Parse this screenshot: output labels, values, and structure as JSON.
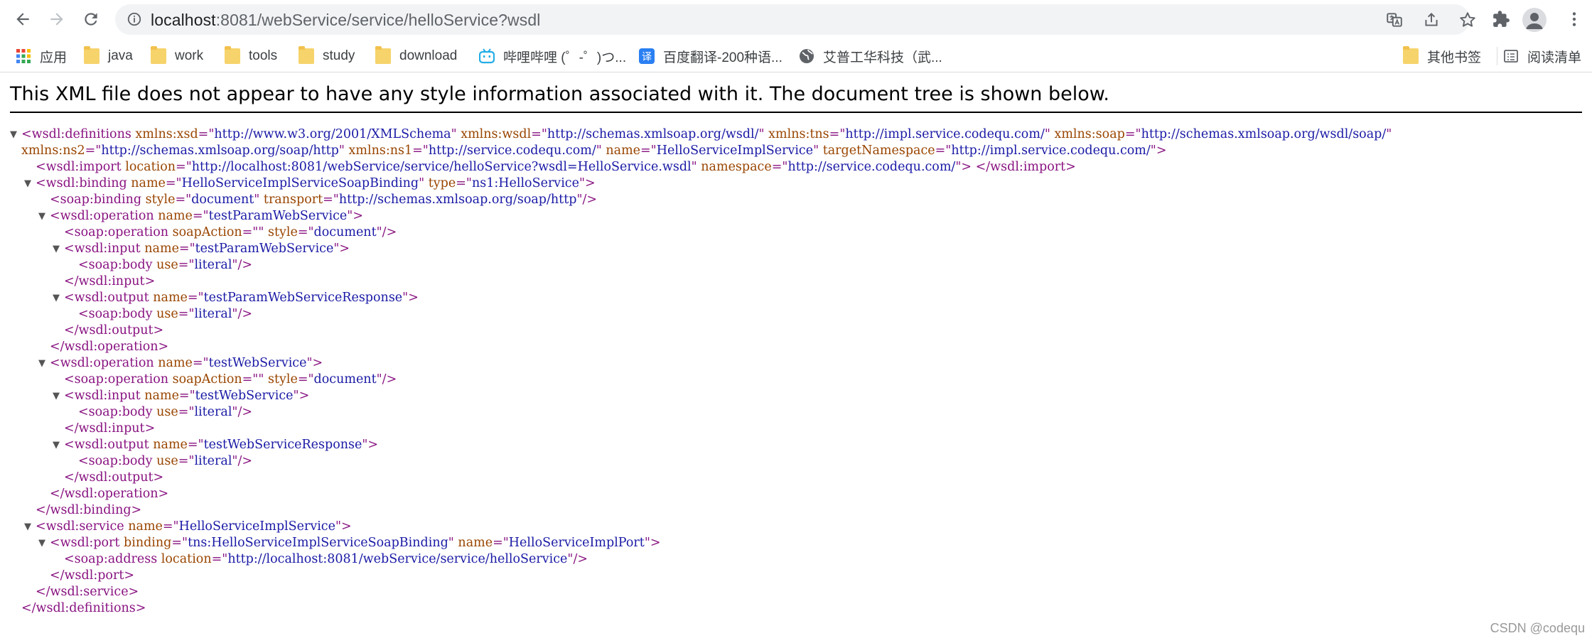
{
  "browser": {
    "url_host": "localhost",
    "url_path": ":8081/webService/service/helloService?wsdl",
    "bookmarks": [
      {
        "label": "应用",
        "icon": "apps-grid-icon"
      },
      {
        "label": "java",
        "icon": "folder-icon"
      },
      {
        "label": "work",
        "icon": "folder-icon"
      },
      {
        "label": "tools",
        "icon": "folder-icon"
      },
      {
        "label": "study",
        "icon": "folder-icon"
      },
      {
        "label": "download",
        "icon": "folder-icon"
      },
      {
        "label": "哔哩哔哩 (゜-゜)つ...",
        "icon": "bilibili-icon"
      },
      {
        "label": "百度翻译-200种语...",
        "icon": "baidu-translate-icon"
      },
      {
        "label": "艾普工华科技（武...",
        "icon": "globe-icon"
      }
    ],
    "other_bookmarks": "其他书签",
    "reading_list": "阅读清单"
  },
  "xml_viewer": {
    "notice": "This XML file does not appear to have any style information associated with it. The document tree is shown below.",
    "lines": [
      {
        "toggle": true,
        "segments": [
          [
            "tag",
            "<wsdl:definitions "
          ],
          [
            "an",
            "xmlns:xsd"
          ],
          [
            "tag",
            "=\""
          ],
          [
            "av",
            "http://www.w3.org/2001/XMLSchema"
          ],
          [
            "tag",
            "\" "
          ],
          [
            "an",
            "xmlns:wsdl"
          ],
          [
            "tag",
            "=\""
          ],
          [
            "av",
            "http://schemas.xmlsoap.org/wsdl/"
          ],
          [
            "tag",
            "\" "
          ],
          [
            "an",
            "xmlns:tns"
          ],
          [
            "tag",
            "=\""
          ],
          [
            "av",
            "http://impl.service.codequ.com/"
          ],
          [
            "tag",
            "\" "
          ],
          [
            "an",
            "xmlns:soap"
          ],
          [
            "tag",
            "=\""
          ],
          [
            "av",
            "http://schemas.xmlsoap.org/wsdl/soap/"
          ],
          [
            "tag",
            "\""
          ]
        ]
      },
      {
        "toggle": false,
        "segments": [
          [
            "an",
            "xmlns:ns2"
          ],
          [
            "tag",
            "=\""
          ],
          [
            "av",
            "http://schemas.xmlsoap.org/soap/http"
          ],
          [
            "tag",
            "\" "
          ],
          [
            "an",
            "xmlns:ns1"
          ],
          [
            "tag",
            "=\""
          ],
          [
            "av",
            "http://service.codequ.com/"
          ],
          [
            "tag",
            "\" "
          ],
          [
            "an",
            "name"
          ],
          [
            "tag",
            "=\""
          ],
          [
            "av",
            "HelloServiceImplService"
          ],
          [
            "tag",
            "\" "
          ],
          [
            "an",
            "targetNamespace"
          ],
          [
            "tag",
            "=\""
          ],
          [
            "av",
            "http://impl.service.codequ.com/"
          ],
          [
            "tag",
            "\">"
          ]
        ]
      },
      {
        "toggle": false,
        "segments": [
          [
            "tag",
            "<wsdl:import "
          ],
          [
            "an",
            "location"
          ],
          [
            "tag",
            "=\""
          ],
          [
            "av",
            "http://localhost:8081/webService/service/helloService?wsdl=HelloService.wsdl"
          ],
          [
            "tag",
            "\" "
          ],
          [
            "an",
            "namespace"
          ],
          [
            "tag",
            "=\""
          ],
          [
            "av",
            "http://service.codequ.com/"
          ],
          [
            "tag",
            "\"> </wsdl:import>"
          ]
        ]
      },
      {
        "toggle": true,
        "segments": [
          [
            "tag",
            "<wsdl:binding "
          ],
          [
            "an",
            "name"
          ],
          [
            "tag",
            "=\""
          ],
          [
            "av",
            "HelloServiceImplServiceSoapBinding"
          ],
          [
            "tag",
            "\" "
          ],
          [
            "an",
            "type"
          ],
          [
            "tag",
            "=\""
          ],
          [
            "av",
            "ns1:HelloService"
          ],
          [
            "tag",
            "\">"
          ]
        ]
      },
      {
        "toggle": false,
        "segments": [
          [
            "tag",
            "<soap:binding "
          ],
          [
            "an",
            "style"
          ],
          [
            "tag",
            "=\""
          ],
          [
            "av",
            "document"
          ],
          [
            "tag",
            "\" "
          ],
          [
            "an",
            "transport"
          ],
          [
            "tag",
            "=\""
          ],
          [
            "av",
            "http://schemas.xmlsoap.org/soap/http"
          ],
          [
            "tag",
            "\"/>"
          ]
        ]
      },
      {
        "toggle": true,
        "segments": [
          [
            "tag",
            "<wsdl:operation "
          ],
          [
            "an",
            "name"
          ],
          [
            "tag",
            "=\""
          ],
          [
            "av",
            "testParamWebService"
          ],
          [
            "tag",
            "\">"
          ]
        ]
      },
      {
        "toggle": false,
        "segments": [
          [
            "tag",
            "<soap:operation "
          ],
          [
            "an",
            "soapAction"
          ],
          [
            "tag",
            "=\"\" "
          ],
          [
            "an",
            "style"
          ],
          [
            "tag",
            "=\""
          ],
          [
            "av",
            "document"
          ],
          [
            "tag",
            "\"/>"
          ]
        ]
      },
      {
        "toggle": true,
        "segments": [
          [
            "tag",
            "<wsdl:input "
          ],
          [
            "an",
            "name"
          ],
          [
            "tag",
            "=\""
          ],
          [
            "av",
            "testParamWebService"
          ],
          [
            "tag",
            "\">"
          ]
        ]
      },
      {
        "toggle": false,
        "segments": [
          [
            "tag",
            "<soap:body "
          ],
          [
            "an",
            "use"
          ],
          [
            "tag",
            "=\""
          ],
          [
            "av",
            "literal"
          ],
          [
            "tag",
            "\"/>"
          ]
        ]
      },
      {
        "toggle": false,
        "segments": [
          [
            "tag",
            "</wsdl:input>"
          ]
        ]
      },
      {
        "toggle": true,
        "segments": [
          [
            "tag",
            "<wsdl:output "
          ],
          [
            "an",
            "name"
          ],
          [
            "tag",
            "=\""
          ],
          [
            "av",
            "testParamWebServiceResponse"
          ],
          [
            "tag",
            "\">"
          ]
        ]
      },
      {
        "toggle": false,
        "segments": [
          [
            "tag",
            "<soap:body "
          ],
          [
            "an",
            "use"
          ],
          [
            "tag",
            "=\""
          ],
          [
            "av",
            "literal"
          ],
          [
            "tag",
            "\"/>"
          ]
        ]
      },
      {
        "toggle": false,
        "segments": [
          [
            "tag",
            "</wsdl:output>"
          ]
        ]
      },
      {
        "toggle": false,
        "segments": [
          [
            "tag",
            "</wsdl:operation>"
          ]
        ]
      },
      {
        "toggle": true,
        "segments": [
          [
            "tag",
            "<wsdl:operation "
          ],
          [
            "an",
            "name"
          ],
          [
            "tag",
            "=\""
          ],
          [
            "av",
            "testWebService"
          ],
          [
            "tag",
            "\">"
          ]
        ]
      },
      {
        "toggle": false,
        "segments": [
          [
            "tag",
            "<soap:operation "
          ],
          [
            "an",
            "soapAction"
          ],
          [
            "tag",
            "=\"\" "
          ],
          [
            "an",
            "style"
          ],
          [
            "tag",
            "=\""
          ],
          [
            "av",
            "document"
          ],
          [
            "tag",
            "\"/>"
          ]
        ]
      },
      {
        "toggle": true,
        "segments": [
          [
            "tag",
            "<wsdl:input "
          ],
          [
            "an",
            "name"
          ],
          [
            "tag",
            "=\""
          ],
          [
            "av",
            "testWebService"
          ],
          [
            "tag",
            "\">"
          ]
        ]
      },
      {
        "toggle": false,
        "segments": [
          [
            "tag",
            "<soap:body "
          ],
          [
            "an",
            "use"
          ],
          [
            "tag",
            "=\""
          ],
          [
            "av",
            "literal"
          ],
          [
            "tag",
            "\"/>"
          ]
        ]
      },
      {
        "toggle": false,
        "segments": [
          [
            "tag",
            "</wsdl:input>"
          ]
        ]
      },
      {
        "toggle": true,
        "segments": [
          [
            "tag",
            "<wsdl:output "
          ],
          [
            "an",
            "name"
          ],
          [
            "tag",
            "=\""
          ],
          [
            "av",
            "testWebServiceResponse"
          ],
          [
            "tag",
            "\">"
          ]
        ]
      },
      {
        "toggle": false,
        "segments": [
          [
            "tag",
            "<soap:body "
          ],
          [
            "an",
            "use"
          ],
          [
            "tag",
            "=\""
          ],
          [
            "av",
            "literal"
          ],
          [
            "tag",
            "\"/>"
          ]
        ]
      },
      {
        "toggle": false,
        "segments": [
          [
            "tag",
            "</wsdl:output>"
          ]
        ]
      },
      {
        "toggle": false,
        "segments": [
          [
            "tag",
            "</wsdl:operation>"
          ]
        ]
      },
      {
        "toggle": false,
        "segments": [
          [
            "tag",
            "</wsdl:binding>"
          ]
        ]
      },
      {
        "toggle": true,
        "segments": [
          [
            "tag",
            "<wsdl:service "
          ],
          [
            "an",
            "name"
          ],
          [
            "tag",
            "=\""
          ],
          [
            "av",
            "HelloServiceImplService"
          ],
          [
            "tag",
            "\">"
          ]
        ]
      },
      {
        "toggle": true,
        "segments": [
          [
            "tag",
            "<wsdl:port "
          ],
          [
            "an",
            "binding"
          ],
          [
            "tag",
            "=\""
          ],
          [
            "av",
            "tns:HelloServiceImplServiceSoapBinding"
          ],
          [
            "tag",
            "\" "
          ],
          [
            "an",
            "name"
          ],
          [
            "tag",
            "=\""
          ],
          [
            "av",
            "HelloServiceImplPort"
          ],
          [
            "tag",
            "\">"
          ]
        ]
      },
      {
        "toggle": false,
        "segments": [
          [
            "tag",
            "<soap:address "
          ],
          [
            "an",
            "location"
          ],
          [
            "tag",
            "=\""
          ],
          [
            "av",
            "http://localhost:8081/webService/service/helloService"
          ],
          [
            "tag",
            "\"/>"
          ]
        ]
      },
      {
        "toggle": false,
        "segments": [
          [
            "tag",
            "</wsdl:port>"
          ]
        ]
      },
      {
        "toggle": false,
        "segments": [
          [
            "tag",
            "</wsdl:service>"
          ]
        ]
      },
      {
        "toggle": false,
        "segments": [
          [
            "tag",
            "</wsdl:definitions>"
          ]
        ]
      }
    ]
  },
  "watermark": "CSDN @codequ",
  "colors": {
    "tag": "#881280",
    "attr_name": "#994500",
    "attr_value": "#1a1aa6",
    "folder": "#f6d36b"
  }
}
